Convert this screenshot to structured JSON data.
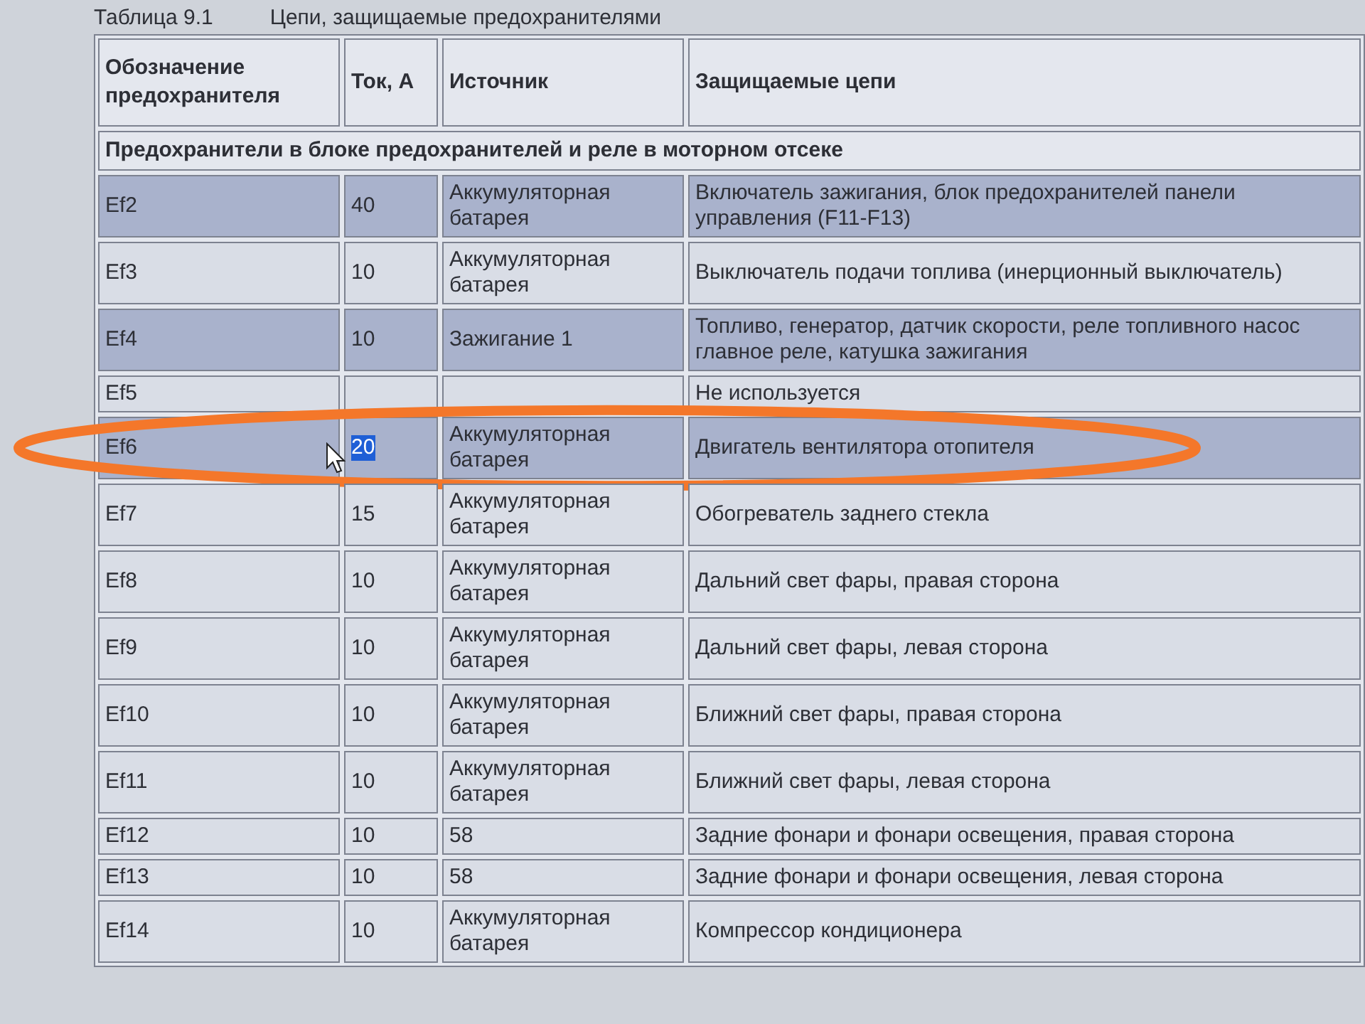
{
  "caption": {
    "number": "Таблица 9.1",
    "title": "Цепи, защищаемые предохранителями"
  },
  "columns": [
    "Обозначение предохранителя",
    "Ток, А",
    "Источник",
    "Защищаемые цепи"
  ],
  "section": "Предохранители в блоке предохранителей и реле в моторном отсеке",
  "rows": [
    {
      "fuse": "Ef2",
      "current": "40",
      "source": "Аккумуляторная батарея",
      "circuits": "Включатель зажигания, блок предохранителей панели управления (F11-F13)",
      "shaded": true,
      "circled": false,
      "current_selected": false
    },
    {
      "fuse": "Ef3",
      "current": "10",
      "source": "Аккумуляторная батарея",
      "circuits": "Выключатель подачи топлива (инерционный выключатель)",
      "shaded": false,
      "circled": false,
      "current_selected": false
    },
    {
      "fuse": "Ef4",
      "current": "10",
      "source": "Зажигание 1",
      "circuits": "Топливо, генератор, датчик скорости, реле топливного насос главное реле, катушка зажигания",
      "shaded": true,
      "circled": false,
      "current_selected": false
    },
    {
      "fuse": "Ef5",
      "current": "",
      "source": "",
      "circuits": "Не используется",
      "shaded": false,
      "circled": false,
      "current_selected": false
    },
    {
      "fuse": "Ef6",
      "current": "20",
      "source": "Аккумуляторная батарея",
      "circuits": "Двигатель вентилятора отопителя",
      "shaded": true,
      "circled": true,
      "current_selected": true
    },
    {
      "fuse": "Ef7",
      "current": "15",
      "source": "Аккумуляторная батарея",
      "circuits": "Обогреватель заднего стекла",
      "shaded": false,
      "circled": false,
      "current_selected": false
    },
    {
      "fuse": "Ef8",
      "current": "10",
      "source": "Аккумуляторная батарея",
      "circuits": "Дальний свет фары, правая сторона",
      "shaded": false,
      "circled": false,
      "current_selected": false
    },
    {
      "fuse": "Ef9",
      "current": "10",
      "source": "Аккумуляторная батарея",
      "circuits": "Дальний свет фары, левая сторона",
      "shaded": false,
      "circled": false,
      "current_selected": false
    },
    {
      "fuse": "Ef10",
      "current": "10",
      "source": "Аккумуляторная батарея",
      "circuits": "Ближний свет фары, правая сторона",
      "shaded": false,
      "circled": false,
      "current_selected": false
    },
    {
      "fuse": "Ef11",
      "current": "10",
      "source": "Аккумуляторная батарея",
      "circuits": "Ближний свет фары, левая сторона",
      "shaded": false,
      "circled": false,
      "current_selected": false
    },
    {
      "fuse": "Ef12",
      "current": "10",
      "source": "58",
      "circuits": "Задние фонари и фонари освещения, правая сторона",
      "shaded": false,
      "circled": false,
      "current_selected": false
    },
    {
      "fuse": "Ef13",
      "current": "10",
      "source": "58",
      "circuits": "Задние фонари и фонари освещения, левая сторона",
      "shaded": false,
      "circled": false,
      "current_selected": false
    },
    {
      "fuse": "Ef14",
      "current": "10",
      "source": "Аккумуляторная батарея",
      "circuits": "Компрессор кондиционера",
      "shaded": false,
      "circled": false,
      "current_selected": false
    }
  ]
}
